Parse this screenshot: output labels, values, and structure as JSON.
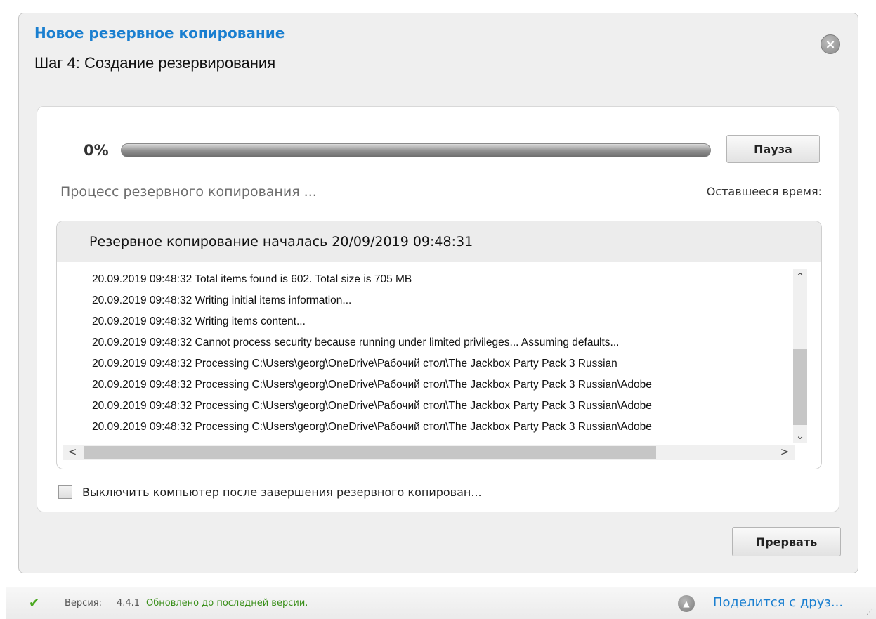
{
  "dialog": {
    "title": "Новое резервное копирование",
    "subtitle": "Шаг 4: Создание резервирования"
  },
  "progress": {
    "percent_label": "0%",
    "value": 0,
    "pause_label": "Пауза",
    "status_text": "Процесс резервного копирования ...",
    "remaining_label": "Оставшееся время:"
  },
  "log": {
    "header": "Резервное копирование началась 20/09/2019 09:48:31",
    "lines": [
      "20.09.2019 09:48:32 Total items found is 602. Total size is 705 MB",
      "20.09.2019 09:48:32 Writing initial items information...",
      "20.09.2019 09:48:32 Writing items content...",
      "20.09.2019 09:48:32 Cannot process security because running under limited privileges... Assuming defaults...",
      "20.09.2019 09:48:32 Processing C:\\Users\\georg\\OneDrive\\Рабочий стол\\The Jackbox Party Pack 3 Russian",
      "20.09.2019 09:48:32 Processing C:\\Users\\georg\\OneDrive\\Рабочий стол\\The Jackbox Party Pack 3 Russian\\Adobe",
      "20.09.2019 09:48:32 Processing C:\\Users\\georg\\OneDrive\\Рабочий стол\\The Jackbox Party Pack 3 Russian\\Adobe",
      "20.09.2019 09:48:32 Processing C:\\Users\\georg\\OneDrive\\Рабочий стол\\The Jackbox Party Pack 3 Russian\\Adobe"
    ]
  },
  "shutdown": {
    "label": "Выключить компьютер после завершения резервного копирован...",
    "checked": false
  },
  "actions": {
    "abort_label": "Прервать"
  },
  "status_bar": {
    "version_label": "Версия:",
    "version_value": "4.4.1",
    "update_status": "Обновлено до последней версии.",
    "share_label": "Поделится с друз..."
  },
  "icons": {
    "close": "close-icon",
    "check": "check-icon",
    "share": "share-icon",
    "scroll_up": "chevron-up-icon",
    "scroll_down": "chevron-down-icon",
    "scroll_left": "chevron-left-icon",
    "scroll_right": "chevron-right-icon"
  },
  "colors": {
    "title_blue": "#1a7fd0",
    "update_green": "#3a8f1a",
    "check_green": "#4aa820"
  }
}
